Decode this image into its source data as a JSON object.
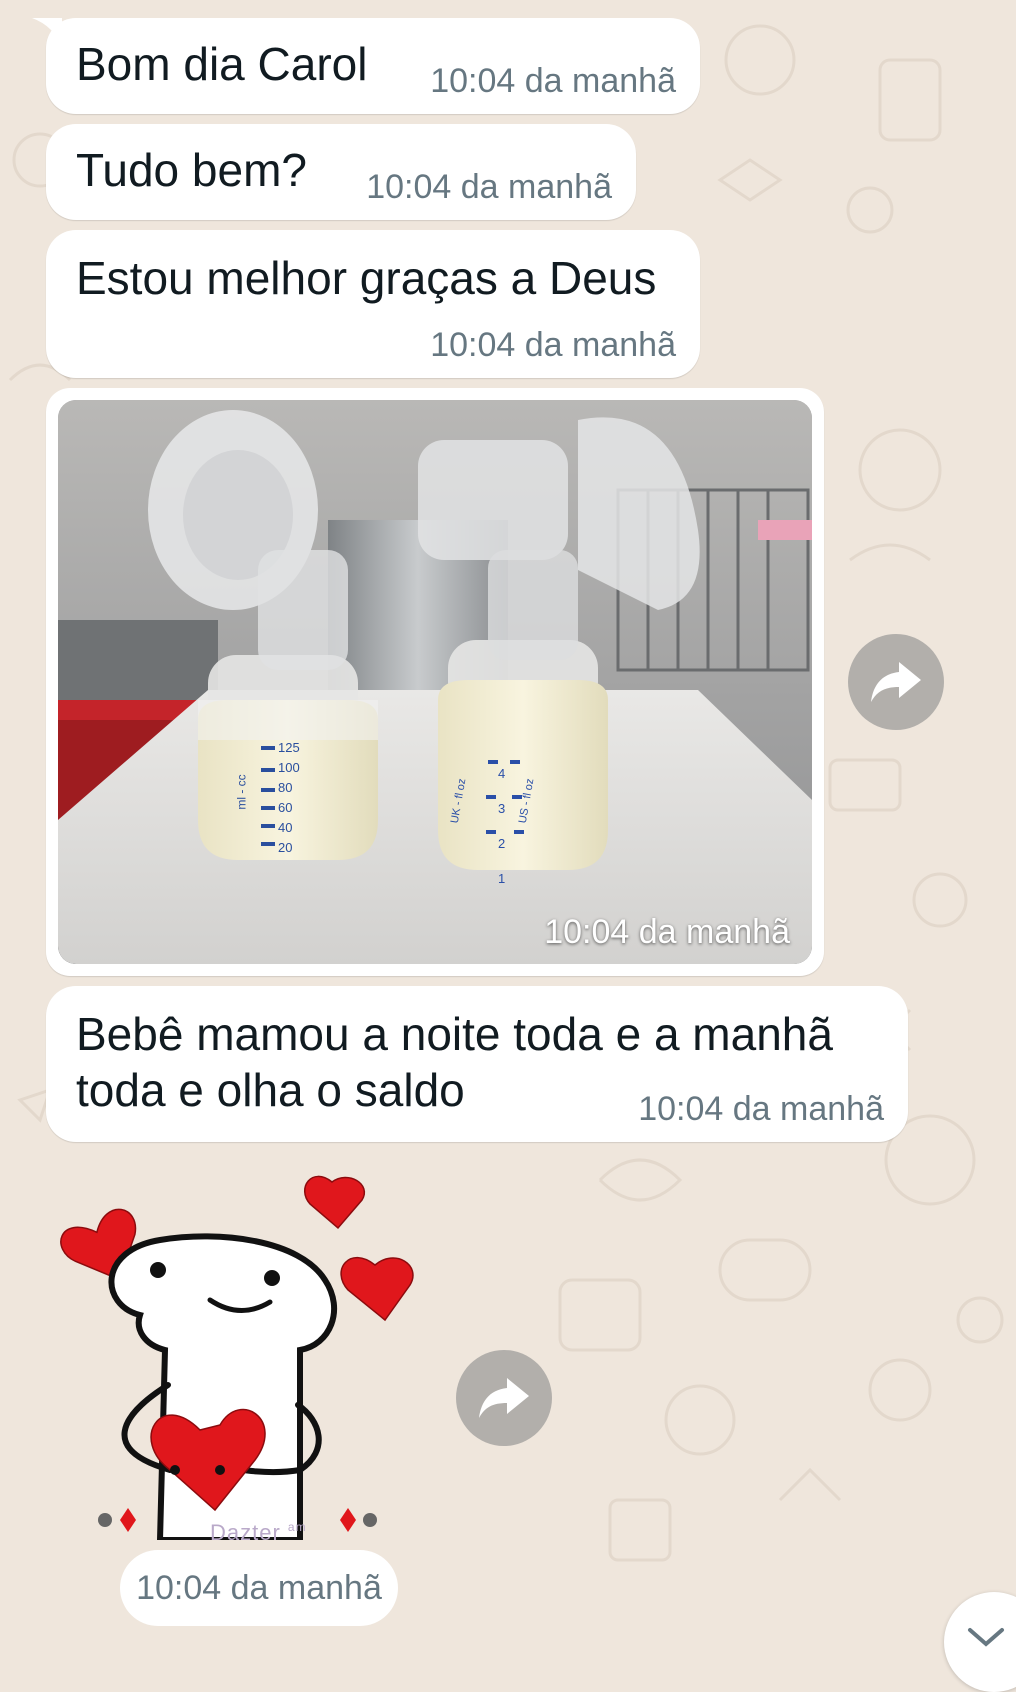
{
  "messages": [
    {
      "type": "text",
      "text": "Bom dia Carol",
      "time": "10:04 da manhã"
    },
    {
      "type": "text",
      "text": "Tudo bem?",
      "time": "10:04 da manhã"
    },
    {
      "type": "text",
      "text": "Estou melhor graças a Deus",
      "time": "10:04 da manhã"
    },
    {
      "type": "image",
      "description": "breast pump bottles with milk",
      "time": "10:04 da manhã",
      "bottle_left": {
        "unit_label": "ml - cc",
        "marks": [
          "125",
          "100",
          "80",
          "60",
          "40",
          "20"
        ]
      },
      "bottle_right": {
        "label_left": "UK - fl oz",
        "label_right": "US - fl oz",
        "marks": [
          "4",
          "3",
          "2",
          "1"
        ]
      }
    },
    {
      "type": "text",
      "text": "Bebê mamou a noite toda e a manhã toda e olha o saldo",
      "time": "10:04 da manhã"
    },
    {
      "type": "sticker",
      "watermark": "Dazter",
      "watermark_small": "am",
      "time": "10:04 da manhã"
    }
  ],
  "colors": {
    "background": "#efe6dc",
    "bubble": "#ffffff",
    "text": "#111b21",
    "timestamp": "#667781",
    "forward_button": "#b2afab",
    "heart": "#e0171c"
  },
  "icons": {
    "forward": "forward-arrow-icon",
    "scroll_down": "chevron-down-icon"
  }
}
